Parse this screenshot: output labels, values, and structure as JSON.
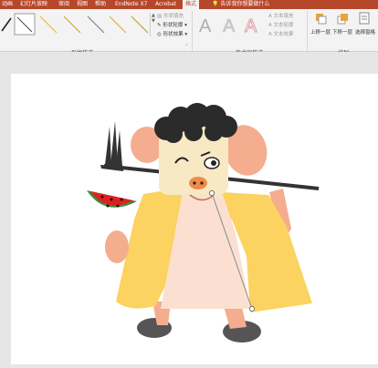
{
  "ribbon_tabs": [
    {
      "label": "动画",
      "active": false
    },
    {
      "label": "幻灯片放映",
      "active": false
    },
    {
      "label": "审阅",
      "active": false
    },
    {
      "label": "视图",
      "active": false
    },
    {
      "label": "帮助",
      "active": false
    },
    {
      "label": "EndNote X7",
      "active": false
    },
    {
      "label": "Acrobat",
      "active": false
    },
    {
      "label": "格式",
      "active": true
    }
  ],
  "tell_me": "告诉我你想要做什么",
  "shape_styles": {
    "group_label": "形状样式",
    "fill_label": "形状填充",
    "outline_label": "形状轮廓",
    "effects_label": "形状效果"
  },
  "wordart_styles": {
    "group_label": "艺术字样式",
    "letter": "A",
    "text_fill_label": "文本填充",
    "text_outline_label": "文本轮廓",
    "text_effects_label": "文本效果"
  },
  "arrange": {
    "group_label": "排列",
    "bring_forward": "上移一层",
    "send_backward": "下移一层",
    "selection_pane": "选择窗格"
  },
  "colors": {
    "brand_red": "#b7472a",
    "coat_yellow": "#fcd260",
    "skin_pink": "#f4ad8f",
    "head_cream": "#f7e9c4",
    "hair": "#2b2b2b",
    "watermelon_red": "#e02020",
    "rind_green": "#3c8c3c"
  }
}
